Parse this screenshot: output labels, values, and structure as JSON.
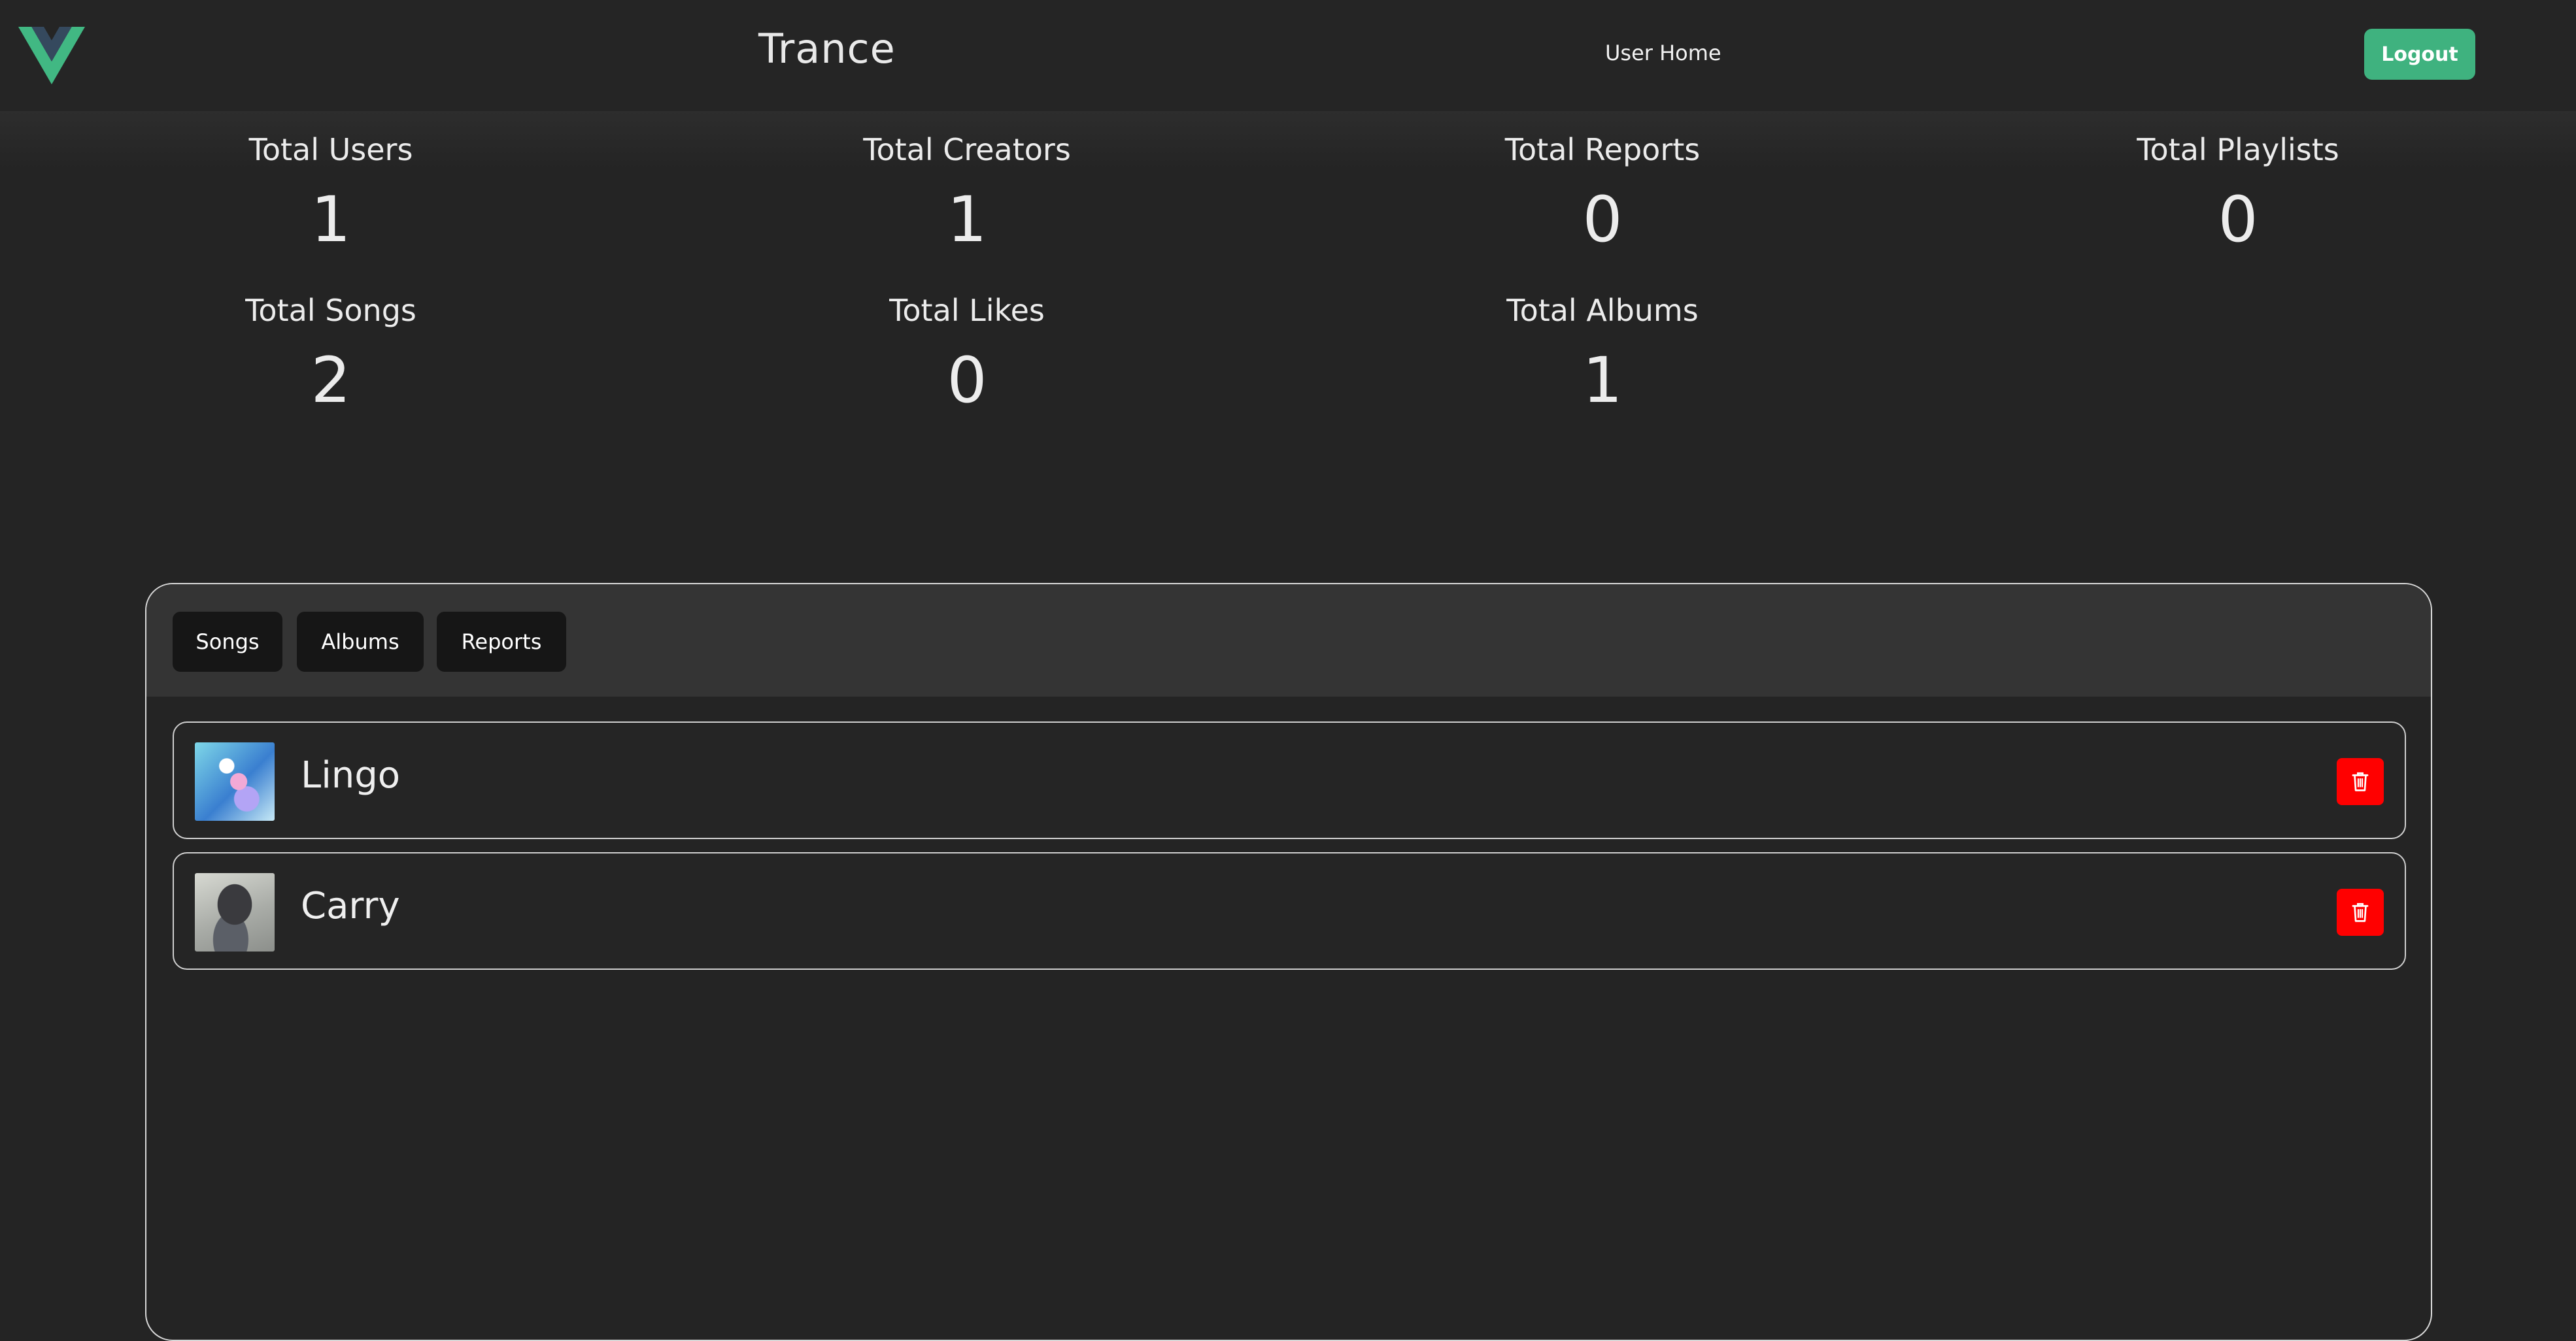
{
  "header": {
    "brand": "Trance",
    "nav_link": "User Home",
    "logout_label": "Logout"
  },
  "stats": [
    {
      "label": "Total Users",
      "value": "1"
    },
    {
      "label": "Total Creators",
      "value": "1"
    },
    {
      "label": "Total Reports",
      "value": "0"
    },
    {
      "label": "Total Playlists",
      "value": "0"
    },
    {
      "label": "Total Songs",
      "value": "2"
    },
    {
      "label": "Total Likes",
      "value": "0"
    },
    {
      "label": "Total Albums",
      "value": "1"
    }
  ],
  "tabs": [
    {
      "label": "Songs"
    },
    {
      "label": "Albums"
    },
    {
      "label": "Reports"
    }
  ],
  "songs": [
    {
      "title": "Lingo"
    },
    {
      "title": "Carry"
    }
  ],
  "icons": {
    "logo": "vue-logo-icon",
    "delete": "trash-icon"
  },
  "colors": {
    "background": "#242424",
    "accent": "#3fb27f",
    "danger": "#ff0000",
    "tab_background": "#161616"
  }
}
